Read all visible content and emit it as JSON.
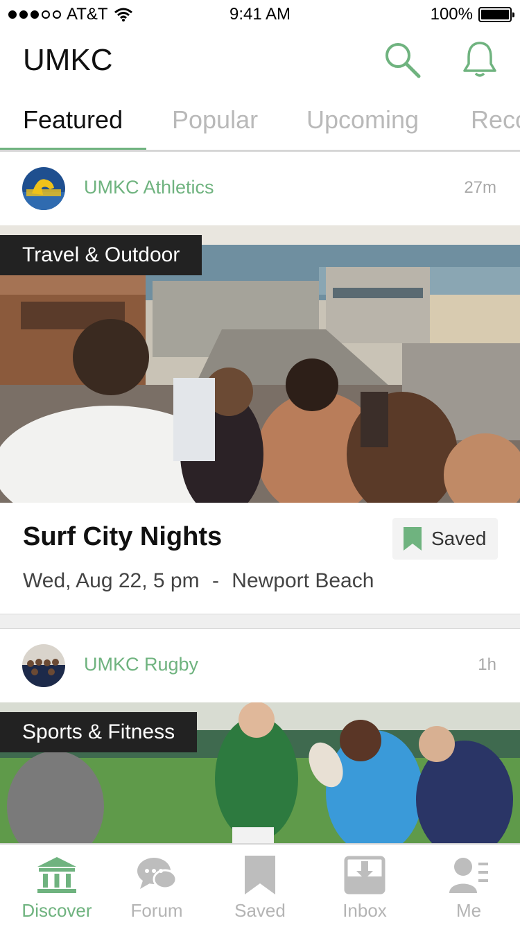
{
  "status_bar": {
    "carrier": "AT&T",
    "time": "9:41 AM",
    "battery": "100%"
  },
  "header": {
    "title": "UMKC",
    "icons": [
      "search-icon",
      "bell-icon"
    ]
  },
  "tabs": [
    {
      "label": "Featured",
      "active": true
    },
    {
      "label": "Popular",
      "active": false
    },
    {
      "label": "Upcoming",
      "active": false
    },
    {
      "label": "Reco",
      "active": false
    }
  ],
  "feed": [
    {
      "author": "UMKC Athletics",
      "time_ago": "27m",
      "category": "Travel & Outdoor",
      "title": "Surf City Nights",
      "date": "Wed, Aug 22, 5 pm",
      "separator": "-",
      "location": "Newport Beach",
      "saved_label": "Saved"
    },
    {
      "author": "UMKC Rugby",
      "time_ago": "1h",
      "category": "Sports & Fitness"
    }
  ],
  "bottom_nav": [
    {
      "label": "Discover",
      "icon": "bank-icon",
      "active": true
    },
    {
      "label": "Forum",
      "icon": "chat-bubbles-icon",
      "active": false
    },
    {
      "label": "Saved",
      "icon": "bookmark-icon",
      "active": false
    },
    {
      "label": "Inbox",
      "icon": "inbox-icon",
      "active": false
    },
    {
      "label": "Me",
      "icon": "profile-icon",
      "active": false
    }
  ],
  "colors": {
    "accent": "#6fb37f",
    "tag_bg": "#222222",
    "inactive": "#b4b4b4"
  }
}
